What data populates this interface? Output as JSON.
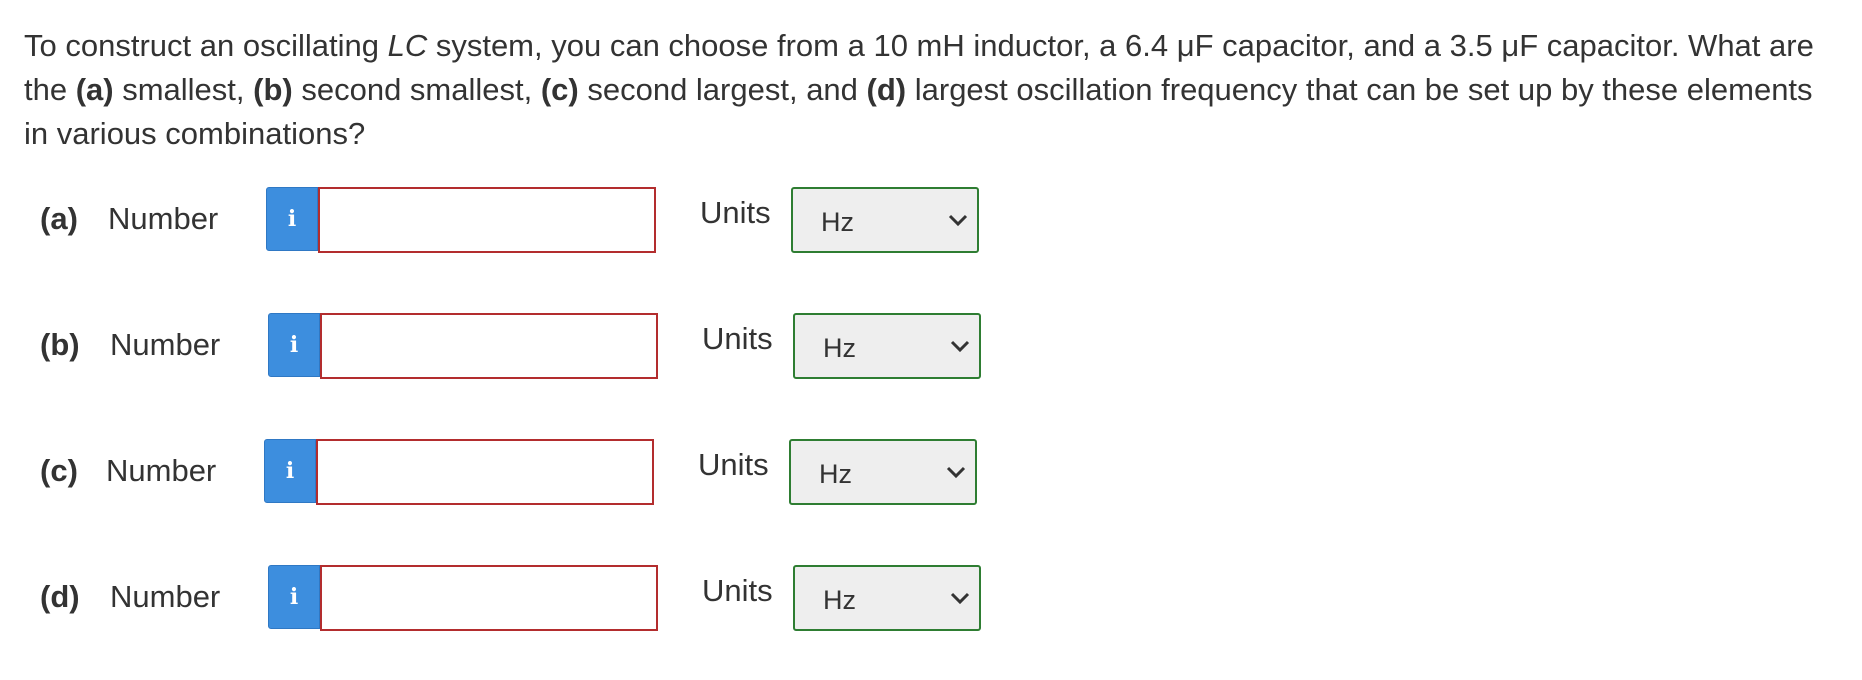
{
  "question": {
    "text_1": "To construct an oscillating ",
    "italic_lc": "LC",
    "text_2": " system, you can choose from a 10 mH inductor, a 6.4 μF capacitor, and a 3.5 μF capacitor. What are the ",
    "a_tag": "(a)",
    "text_3": " smallest, ",
    "b_tag": "(b)",
    "text_4": " second smallest, ",
    "c_tag": "(c)",
    "text_5": " second largest, and ",
    "d_tag": "(d)",
    "text_6": " largest oscillation frequency that can be set up by these elements in various combinations?"
  },
  "parts": [
    {
      "label": "(a)",
      "number_label": "Number",
      "info_icon": "i",
      "value": "",
      "units_label": "Units",
      "unit": "Hz"
    },
    {
      "label": "(b)",
      "number_label": "Number",
      "info_icon": "i",
      "value": "",
      "units_label": "Units",
      "unit": "Hz"
    },
    {
      "label": "(c)",
      "number_label": "Number",
      "info_icon": "i",
      "value": "",
      "units_label": "Units",
      "unit": "Hz"
    },
    {
      "label": "(d)",
      "number_label": "Number",
      "info_icon": "i",
      "value": "",
      "units_label": "Units",
      "unit": "Hz"
    }
  ],
  "colors": {
    "info_button": "#3d8ede",
    "input_border_invalid": "#b32d2e",
    "select_border": "#2e7d32",
    "select_background": "#eeeeee",
    "text": "#333333"
  },
  "icons": {
    "info": "info-icon",
    "dropdown": "chevron-down-icon"
  }
}
